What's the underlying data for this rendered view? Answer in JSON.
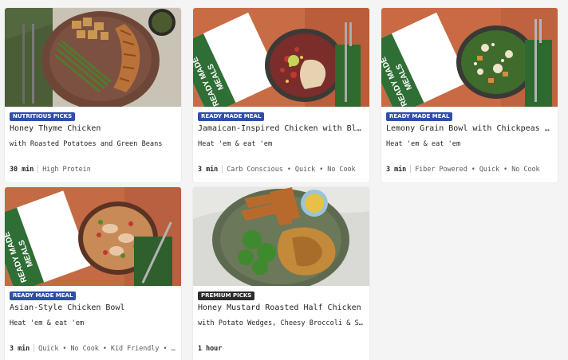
{
  "colors": {
    "badge_nutritious": "#2f4ea8",
    "badge_ready": "#2f4ea8",
    "badge_premium": "#2b2b2b"
  },
  "cards": [
    {
      "badge": "NUTRITIOUS PICKS",
      "title": "Honey Thyme Chicken",
      "subtitle": "with Roasted Potatoes and Green Beans",
      "time": "30 min",
      "tags": "High Protein",
      "image": "plate-chicken-potatoes-green-beans"
    },
    {
      "badge": "READY MADE MEAL",
      "title": "Jamaican-Inspired Chicken with Black Beans",
      "subtitle": "Heat 'em & eat 'em",
      "time": "3 min",
      "tags": "Carb Conscious • Quick • No Cook",
      "image": "ready-made-tray-black-bean-bowl",
      "package_text": "READY MADE MEALS"
    },
    {
      "badge": "READY MADE MEAL",
      "title": "Lemony Grain Bowl with Chickpeas and Chicken",
      "subtitle": "Heat 'em & eat 'em",
      "time": "3 min",
      "tags": "Fiber Powered • Quick • No Cook",
      "image": "ready-made-tray-grain-bowl",
      "package_text": "READY MADE MEALS"
    },
    {
      "badge": "READY MADE MEAL",
      "title": "Asian-Style Chicken Bowl",
      "subtitle": "Heat 'em & eat 'em",
      "time": "3 min",
      "tags": "Quick • No Cook • Kid Friendly • ...",
      "image": "ready-made-tray-chicken-rice-bowl",
      "package_text": "READY MADE MEALS"
    },
    {
      "badge": "PREMIUM PICKS",
      "title": "Honey Mustard Roasted Half Chicken",
      "subtitle": "with Potato Wedges, Cheesy Broccoli & Smoky Mayo",
      "time": "1 hour",
      "tags": "",
      "image": "plate-half-chicken-wedges-broccoli"
    }
  ]
}
